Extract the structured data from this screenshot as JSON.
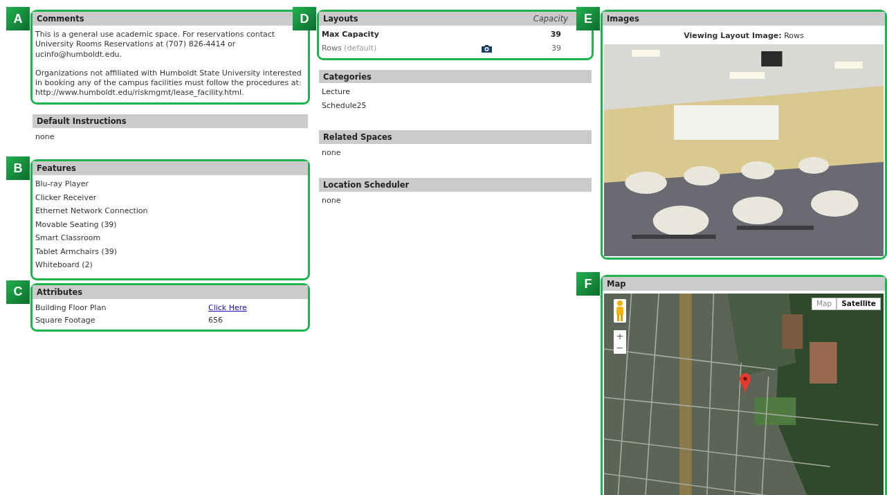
{
  "columns": [
    {
      "sections": [
        {
          "title": "Comments",
          "callout": "A",
          "kind": "paragraphs",
          "items": [
            "This is a general use academic space. For reservations contact University Rooms Reservations at (707) 826-4414 or ucinfo@humboldt.edu.",
            "Organizations not affiliated with Humboldt State University interested in booking any of the campus facilities must follow the procedures at: http://www.humboldt.edu/riskmgmt/lease_facility.html."
          ]
        },
        {
          "title": "Default Instructions",
          "kind": "list",
          "items": [
            "none"
          ]
        },
        {
          "title": "Features",
          "callout": "B",
          "kind": "list",
          "items": [
            "Blu-ray Player",
            "Clicker Receiver",
            "Ethernet Network Connection",
            "Movable Seating (39)",
            "Smart Classroom",
            "Tablet Armchairs (39)",
            "Whiteboard (2)"
          ]
        },
        {
          "title": "Attributes",
          "callout": "C",
          "kind": "attributes",
          "rows": [
            {
              "label": "Building Floor Plan",
              "value": "Click Here",
              "kind": "link"
            },
            {
              "label": "Square Footage",
              "value": "656",
              "kind": "text"
            }
          ]
        }
      ]
    },
    {
      "sections": [
        {
          "title": "Layouts",
          "callout": "D",
          "kind": "layouts",
          "column_header": "Capacity",
          "rows": [
            {
              "name": "Max Capacity",
              "capacity": "39",
              "kind": "total"
            },
            {
              "name": "Rows",
              "note": "(default)",
              "capacity": "39",
              "kind": "layout",
              "has_image": true
            }
          ]
        },
        {
          "title": "Categories",
          "kind": "list",
          "items": [
            "Lecture",
            "Schedule25"
          ]
        },
        {
          "title": "Related Spaces",
          "kind": "list",
          "items": [
            "none"
          ]
        },
        {
          "title": "Location Scheduler",
          "kind": "list",
          "items": [
            "none"
          ]
        }
      ]
    },
    {
      "sections": [
        {
          "title": "Images",
          "callout": "E",
          "caption": "**Viewing Layout Image:** Rows"
        },
        {
          "title": "Map",
          "callout": "F",
          "kind": "map",
          "map_types": [
            {
              "label": "Map",
              "selected": false
            },
            {
              "label": "Satellite",
              "selected": true
            }
          ],
          "zoom_controls": [
            "+",
            "−"
          ]
        }
      ]
    }
  ]
}
